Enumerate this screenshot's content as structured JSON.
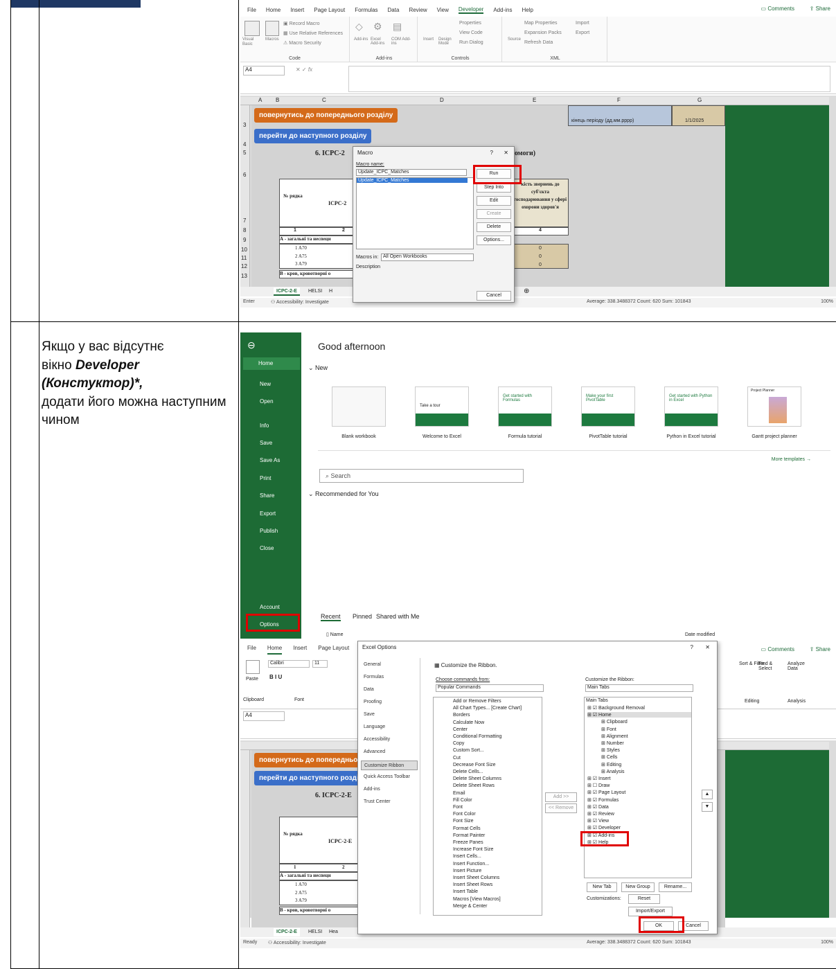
{
  "note": {
    "line1": "Якщо у вас відсутнє",
    "line2": "вікно ",
    "bold": "Developer (Констуктор)*,",
    "line3": "додати його можна наступним чином"
  },
  "excel_top": {
    "tabs": [
      "File",
      "Home",
      "Insert",
      "Page Layout",
      "Formulas",
      "Data",
      "Review",
      "View",
      "Developer",
      "Add-ins",
      "Help"
    ],
    "active_tab": "Developer",
    "comments": "Comments",
    "share": "Share",
    "code_group": {
      "label": "Code",
      "visual_basic": "Visual Basic",
      "macros": "Macros",
      "record": "Record Macro",
      "relative": "Use Relative References",
      "security": "Macro Security"
    },
    "addins_group": {
      "label": "Add-ins",
      "addins": "Add-ins",
      "excel_addins": "Excel Add-ins",
      "com_addins": "COM Add-ins"
    },
    "controls_group": {
      "label": "Controls",
      "insert": "Insert",
      "design": "Design Mode",
      "properties": "Properties",
      "view_code": "View Code",
      "run_dialog": "Run Dialog"
    },
    "xml_group": {
      "label": "XML",
      "source": "Source",
      "map_props": "Map Properties",
      "expansion": "Expansion Packs",
      "refresh": "Refresh Data",
      "import": "Import",
      "export": "Export"
    },
    "name_box": "A4",
    "fx": "fx",
    "cols": [
      "A",
      "B",
      "C",
      "D",
      "E",
      "F",
      "G"
    ],
    "rows": [
      "3",
      "4",
      "5",
      "6",
      "7",
      "8",
      "9",
      "10",
      "11",
      "12",
      "13"
    ],
    "btn_back": "повернутись до попереднього розділу",
    "btn_next": "перейти до наступного розділу",
    "heading": "6. ICPC-2",
    "heading_tail": "омоги)",
    "period_label": "кінець періоду (дд.мм.рррр)",
    "period_value": "1/1/2025",
    "col_no": "№ рядка",
    "col_icpc": "ICPC-2",
    "col_count": "кість звернень до суб'єкта господарювання у сфері охорони здоров'я",
    "num1": "1",
    "num2": "2",
    "num4": "4",
    "section_a": "А - загальні та неспеци",
    "codes": [
      "A70",
      "A75",
      "A79"
    ],
    "code_nums": [
      "1",
      "2",
      "3"
    ],
    "zeros": [
      "0",
      "0",
      "0"
    ],
    "section_b": "В - кров, кровотворні о",
    "sheet_tabs": [
      "ICPC-2-E",
      "HELSI",
      "H"
    ],
    "status_mode": "Enter",
    "accessibility": "Accessibility: Investigate",
    "stats": "Average: 338.3488372   Count: 620   Sum: 101843",
    "zoom": "100%"
  },
  "macro_dialog": {
    "title": "Macro",
    "help": "?",
    "close": "✕",
    "name_label": "Macro name:",
    "name_value": "Update_ICPC_Matches",
    "list_item": "Update_ICPC_Matches",
    "run": "Run",
    "step_into": "Step Into",
    "edit": "Edit",
    "create": "Create",
    "delete": "Delete",
    "options": "Options...",
    "macros_in_label": "Macros in:",
    "macros_in_value": "All Open Workbooks",
    "description": "Description",
    "cancel": "Cancel"
  },
  "backstage": {
    "greeting": "Good afternoon",
    "nav": [
      "Home",
      "New",
      "Open",
      "Info",
      "Save",
      "Save As",
      "Print",
      "Share",
      "Export",
      "Publish",
      "Close",
      "Account",
      "Options"
    ],
    "new_label": "New",
    "templates": [
      "Blank workbook",
      "Welcome to Excel",
      "Formula tutorial",
      "PivotTable tutorial",
      "Python in Excel tutorial",
      "Gantt project planner"
    ],
    "card_text": [
      "",
      "Take a tour",
      "Get started with Formulas",
      "Make your first PivotTable",
      "Get started with Python in Excel",
      "Project Planner"
    ],
    "more_templates": "More templates",
    "search": "Search",
    "recommended": "Recommended for You",
    "tabs": [
      "Recent",
      "Pinned",
      "Shared with Me"
    ],
    "col_name": "Name",
    "col_date": "Date modified"
  },
  "excel_bottom": {
    "tabs": [
      "File",
      "Home",
      "Insert",
      "Page Layout"
    ],
    "font": "Calibri",
    "size": "11",
    "paste": "Paste",
    "clipboard": "Clipboard",
    "font_label": "Font",
    "sort": "Sort & Filter",
    "find": "Find & Select",
    "analyze": "Analyze Data",
    "editing": "Editing",
    "analysis": "Analysis",
    "heading": "6. ICPC-2-E",
    "col_icpc": "ICPC-2-E",
    "sheet_tabs": [
      "ICPC-2-E",
      "HELSI",
      "Hea"
    ],
    "status_mode": "Ready"
  },
  "options_dialog": {
    "title": "Excel Options",
    "categories": [
      "General",
      "Formulas",
      "Data",
      "Proofing",
      "Save",
      "Language",
      "Accessibility",
      "Advanced",
      "Customize Ribbon",
      "Quick Access Toolbar",
      "Add-ins",
      "Trust Center"
    ],
    "active_category": "Customize Ribbon",
    "header": "Customize the Ribbon.",
    "choose_label": "Choose commands from:",
    "choose_value": "Popular Commands",
    "customize_label": "Customize the Ribbon:",
    "customize_value": "Main Tabs",
    "commands": [
      "Add or Remove Filters",
      "All Chart Types... [Create Chart]",
      "Borders",
      "Calculate Now",
      "Center",
      "Conditional Formatting",
      "Copy",
      "Custom Sort...",
      "Cut",
      "Decrease Font Size",
      "Delete Cells...",
      "Delete Sheet Columns",
      "Delete Sheet Rows",
      "Email",
      "Fill Color",
      "Font",
      "Font Color",
      "Font Size",
      "Format Cells",
      "Format Painter",
      "Freeze Panes",
      "Increase Font Size",
      "Insert Cells...",
      "Insert Function...",
      "Insert Picture",
      "Insert Sheet Columns",
      "Insert Sheet Rows",
      "Insert Table",
      "Macros [View Macros]",
      "Merge & Center"
    ],
    "add": "Add >>",
    "remove": "<< Remove",
    "main_tabs_header": "Main Tabs",
    "tree": [
      "Background Removal",
      "Home",
      "Clipboard",
      "Font",
      "Alignment",
      "Number",
      "Styles",
      "Cells",
      "Editing",
      "Analysis",
      "Insert",
      "Draw",
      "Page Layout",
      "Formulas",
      "Data",
      "Review",
      "View",
      "Developer",
      "Add-ins",
      "Help"
    ],
    "new_tab": "New Tab",
    "new_group": "New Group",
    "rename": "Rename...",
    "customizations": "Customizations:",
    "reset": "Reset",
    "import_export": "Import/Export",
    "ok": "OK",
    "cancel": "Cancel"
  }
}
